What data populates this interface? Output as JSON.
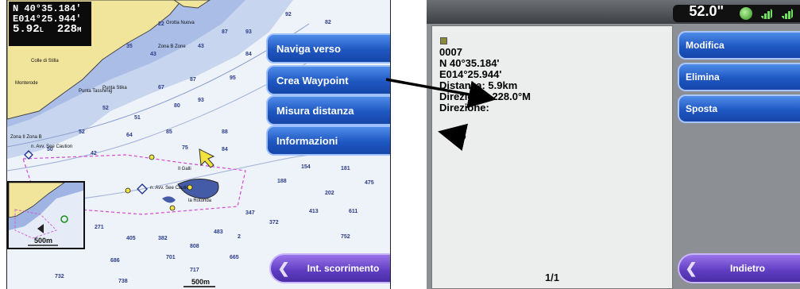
{
  "chart_screen": {
    "position": {
      "lat": "N  40°35.184'",
      "lon": "E014°25.944'",
      "dist": "5.92",
      "dist_unit": "L",
      "bearing": "228",
      "bearing_unit": "M"
    },
    "menu": [
      "Naviga verso",
      "Crea Waypoint",
      "Misura distanza",
      "Informazioni"
    ],
    "scroll_button": "Int. scorrimento",
    "scale_top": "500m",
    "scale_bottom": "500m"
  },
  "waypoint_screen": {
    "status": {
      "depth": "52.0\""
    },
    "waypoint": {
      "name": "0007",
      "lat": "N  40°35.184'",
      "lon": "E014°25.944'",
      "distance": "Distanza: 5.9km",
      "direction": "Direzione: 228.0°M",
      "heading": "Direzione:"
    },
    "actions": [
      "Modifica",
      "Elimina",
      "Sposta"
    ],
    "back_button": "Indietro",
    "page": "1/1"
  }
}
